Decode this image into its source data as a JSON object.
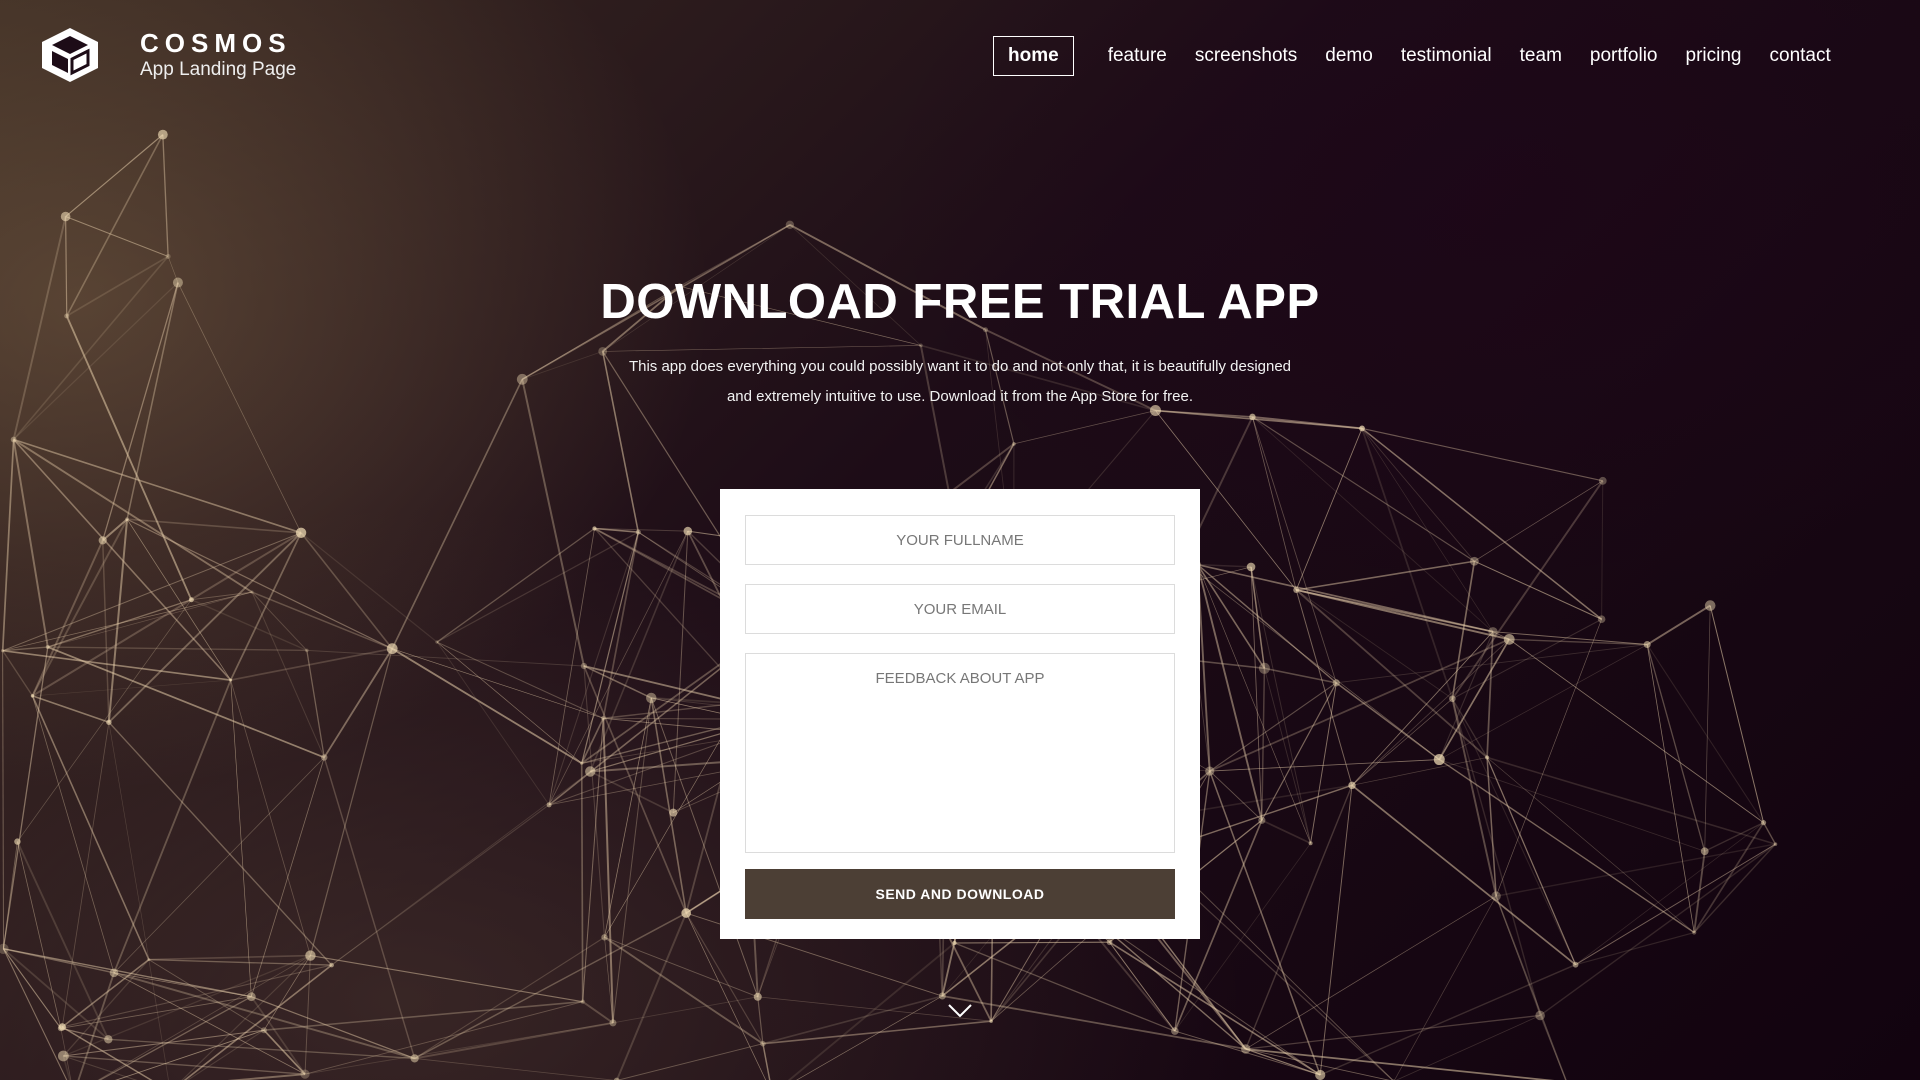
{
  "brand": {
    "title": "COSMOS",
    "subtitle": "App Landing Page",
    "logo_icon": "cube-logo-icon"
  },
  "nav": {
    "items": [
      {
        "label": "home",
        "active": true
      },
      {
        "label": "feature"
      },
      {
        "label": "screenshots"
      },
      {
        "label": "demo"
      },
      {
        "label": "testimonial"
      },
      {
        "label": "team"
      },
      {
        "label": "portfolio"
      },
      {
        "label": "pricing"
      },
      {
        "label": "contact"
      }
    ]
  },
  "hero": {
    "heading": "DOWNLOAD FREE TRIAL APP",
    "description_line1": "This app does everything you could possibly want it to do and not only that, it is beautifully designed",
    "description_line2": "and extremely intuitive to use.  Download it from the App Store for free."
  },
  "form": {
    "fullname_placeholder": "YOUR FULLNAME",
    "email_placeholder": "YOUR EMAIL",
    "feedback_placeholder": "FEEDBACK ABOUT APP",
    "submit_label": "SEND AND DOWNLOAD"
  },
  "scroll": {
    "icon": "chevron-down-icon"
  },
  "colors": {
    "background": "#140611",
    "button": "#4c3f35",
    "card": "#ffffff"
  }
}
